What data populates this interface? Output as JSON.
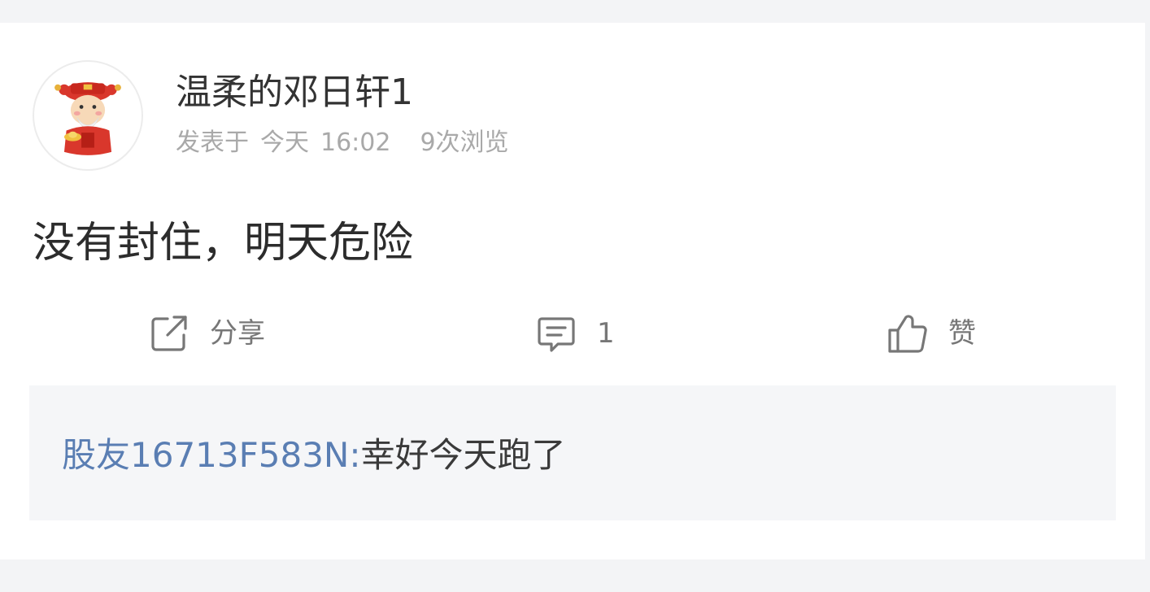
{
  "post": {
    "username": "温柔的邓日轩1",
    "meta": {
      "posted_prefix": "发表于",
      "date": "今天",
      "time": "16:02",
      "views": "9次浏览"
    },
    "content": "没有封住，明天危险"
  },
  "actions": {
    "share": {
      "icon": "share-icon",
      "label": "分享"
    },
    "comment": {
      "icon": "comment-icon",
      "label": "1"
    },
    "like": {
      "icon": "thumbs-up-icon",
      "label": "赞"
    }
  },
  "comments": [
    {
      "author": "股友16713F583N:",
      "text": "幸好今天跑了"
    }
  ],
  "colors": {
    "comment_author": "#5a7eb3",
    "page_background": "#f3f4f6",
    "comment_background": "#f5f6f8"
  },
  "avatar": {
    "icon": "fortune-god-avatar"
  }
}
